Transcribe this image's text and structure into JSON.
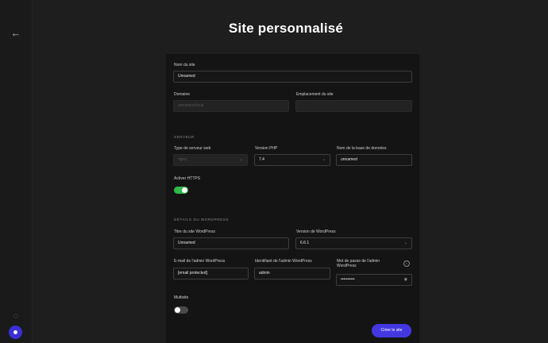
{
  "header": {
    "title": "Site personnalisé"
  },
  "sidebar": {
    "back_icon": "arrow-left-icon",
    "help_icon": "question-circle-icon",
    "avatar_icon": "user-avatar-icon"
  },
  "form": {
    "site_name": {
      "label": "Nom du site",
      "value": "Unnamed"
    },
    "domain": {
      "label": "Domaine",
      "value": "unnamed.local"
    },
    "site_path": {
      "label": "Emplacement du site",
      "value": ""
    },
    "env_section": "Serveur",
    "web_server": {
      "label": "Type de serveur web",
      "value": "nginx"
    },
    "php_version": {
      "label": "Version PHP",
      "value": "7.4"
    },
    "db_name": {
      "label": "Nom de la base de données",
      "value": "unnamed"
    },
    "https": {
      "label": "Activer HTTPS",
      "enabled": true
    },
    "wp_section": "Détails du WordPress",
    "wp_title": {
      "label": "Titre du site WordPress",
      "value": "Unnamed"
    },
    "wp_version": {
      "label": "Version de WordPress",
      "value": "6.6.1"
    },
    "admin_email": {
      "label": "E-mail de l'admin WordPress",
      "value": "[email protected]"
    },
    "admin_user": {
      "label": "Identifiant de l'admin WordPress",
      "value": "admin"
    },
    "admin_password": {
      "label": "Mot de passe de l'admin WordPress",
      "value": "••••••••••"
    },
    "multisite": {
      "label": "Multisite",
      "enabled": false
    }
  },
  "actions": {
    "create_label": "Créer le site"
  }
}
